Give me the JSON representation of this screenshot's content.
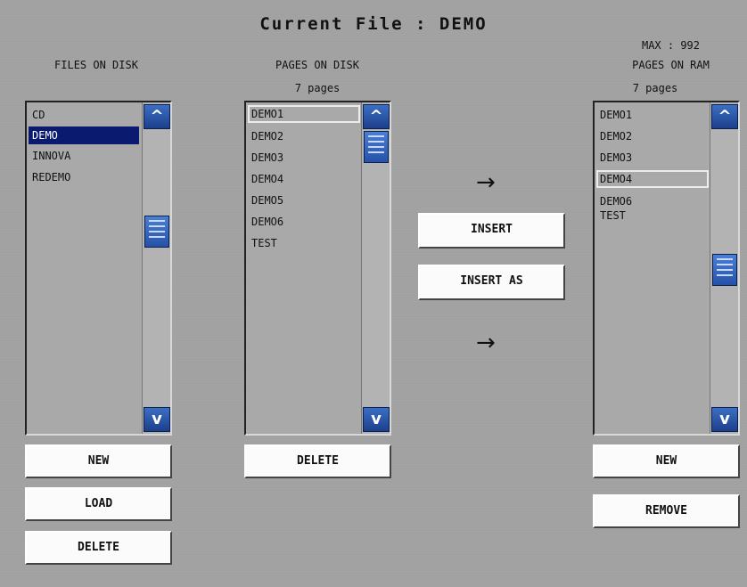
{
  "title": "Current File  : DEMO",
  "files_panel": {
    "header": "FILES ON DISK",
    "items": [
      "CD",
      "DEMO",
      "INNOVA",
      "REDEMO"
    ],
    "selected": "DEMO",
    "buttons": {
      "new": "NEW",
      "load": "LOAD",
      "delete": "DELETE"
    }
  },
  "pages_disk_panel": {
    "header": "PAGES ON DISK",
    "count": "7 pages",
    "items": [
      "DEMO1",
      "DEMO2",
      "DEMO3",
      "DEMO4",
      "DEMO5",
      "DEMO6",
      "TEST"
    ],
    "focused": "DEMO1",
    "buttons": {
      "delete": "DELETE"
    }
  },
  "middle": {
    "insert_label": "INSERT",
    "insert_as_label": "INSERT AS",
    "arrow_symbol": "→"
  },
  "pages_ram_panel": {
    "max": "MAX : 992",
    "header": "PAGES ON RAM",
    "count": "7 pages",
    "items": [
      "DEMO1",
      "DEMO2",
      "DEMO3",
      "DEMO4",
      "DEMO6",
      "TEST"
    ],
    "focused": "DEMO4",
    "buttons": {
      "new": "NEW",
      "remove": "REMOVE"
    }
  },
  "scroll_symbols": {
    "up": "^",
    "down": "v"
  },
  "colors": {
    "selection": "#0a1a6e",
    "scroll_blue": "#2552a8",
    "background": "#a3a3a3"
  }
}
